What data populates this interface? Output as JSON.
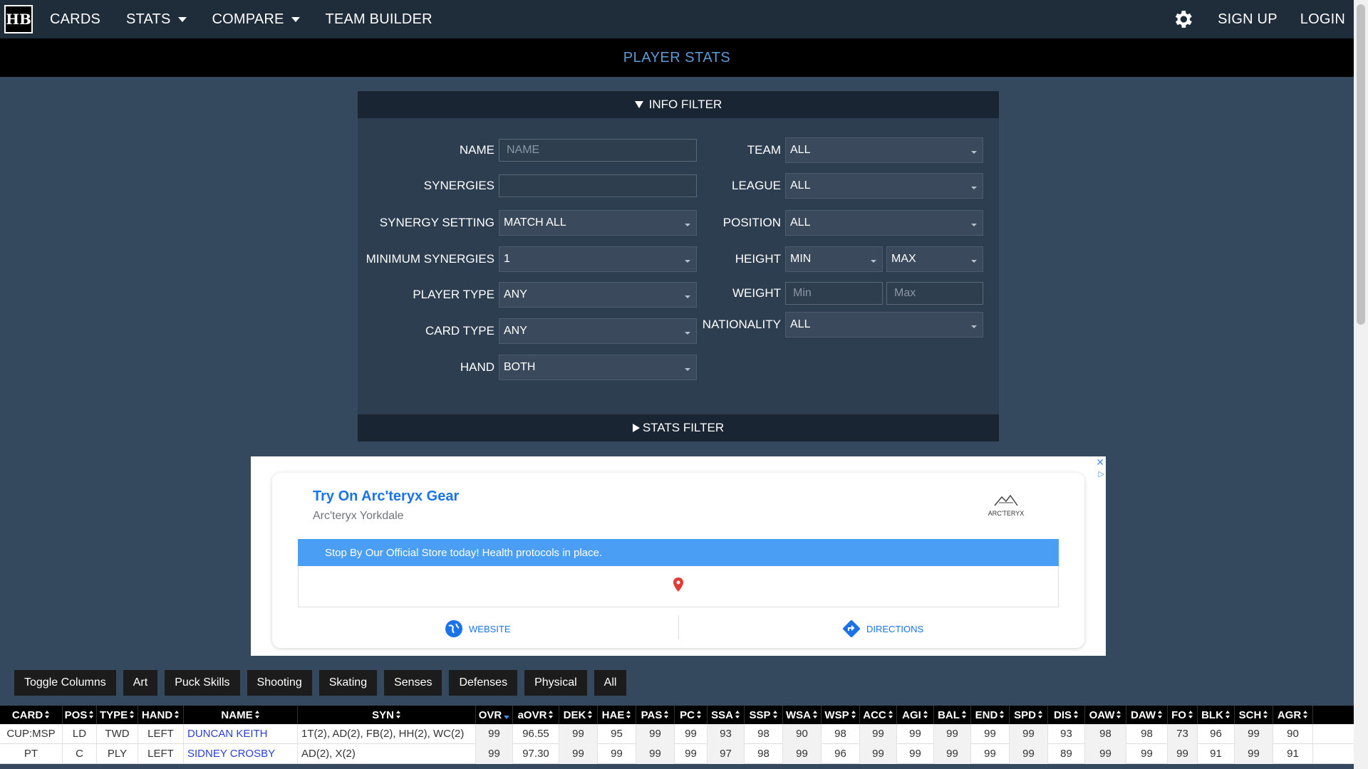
{
  "nav": {
    "logo": "HB",
    "items": [
      "CARDS",
      "STATS",
      "COMPARE",
      "TEAM BUILDER"
    ],
    "signup": "SIGN UP",
    "login": "LOGIN"
  },
  "page_title": "PLAYER STATS",
  "filter": {
    "info_label": "INFO FILTER",
    "stats_label": "STATS FILTER",
    "left": [
      {
        "label": "NAME",
        "value": "",
        "placeholder": "NAME",
        "kind": "input"
      },
      {
        "label": "SYNERGIES",
        "value": "",
        "kind": "input"
      },
      {
        "label": "SYNERGY SETTING",
        "value": "MATCH ALL",
        "kind": "select"
      },
      {
        "label": "MINIMUM SYNERGIES",
        "value": "1",
        "kind": "select"
      },
      {
        "label": "PLAYER TYPE",
        "value": "ANY",
        "kind": "select"
      },
      {
        "label": "CARD TYPE",
        "value": "ANY",
        "kind": "select"
      },
      {
        "label": "HAND",
        "value": "BOTH",
        "kind": "select"
      }
    ],
    "right": {
      "team": {
        "label": "TEAM",
        "value": "ALL"
      },
      "league": {
        "label": "LEAGUE",
        "value": "ALL"
      },
      "position": {
        "label": "POSITION",
        "value": "ALL"
      },
      "height": {
        "label": "HEIGHT",
        "min": "MIN",
        "max": "MAX"
      },
      "weight": {
        "label": "WEIGHT",
        "min_placeholder": "Min",
        "max_placeholder": "Max"
      },
      "nationality": {
        "label": "NATIONALITY",
        "value": "ALL"
      }
    }
  },
  "ad": {
    "title": "Try On Arc'teryx Gear",
    "subtitle": "Arc'teryx Yorkdale",
    "logo_text": "ARC'TERYX",
    "banner": "Stop By Our Official Store today! Health protocols in place.",
    "website": "WEBSITE",
    "directions": "DIRECTIONS",
    "accent": "#4a9ff5"
  },
  "toggles": [
    "Toggle Columns",
    "Art",
    "Puck Skills",
    "Shooting",
    "Skating",
    "Senses",
    "Defenses",
    "Physical",
    "All"
  ],
  "table": {
    "columns": [
      "CARD",
      "POS",
      "TYPE",
      "HAND",
      "NAME",
      "SYN",
      "OVR",
      "aOVR",
      "DEK",
      "HAE",
      "PAS",
      "PC",
      "SSA",
      "SSP",
      "WSA",
      "WSP",
      "ACC",
      "AGI",
      "BAL",
      "END",
      "SPD",
      "DIS",
      "OAW",
      "DAW",
      "FO",
      "BLK",
      "SCH",
      "AGR"
    ],
    "rows": [
      [
        "CUP:MSP",
        "LD",
        "TWD",
        "LEFT",
        "DUNCAN KEITH",
        "1T(2), AD(2), FB(2), HH(2), WC(2)",
        "99",
        "96.55",
        "99",
        "95",
        "99",
        "99",
        "93",
        "98",
        "90",
        "98",
        "99",
        "99",
        "99",
        "99",
        "99",
        "93",
        "98",
        "98",
        "73",
        "96",
        "99",
        "90"
      ],
      [
        "PT",
        "C",
        "PLY",
        "LEFT",
        "SIDNEY CROSBY",
        "AD(2), X(2)",
        "99",
        "97.30",
        "99",
        "99",
        "99",
        "99",
        "97",
        "98",
        "99",
        "96",
        "99",
        "99",
        "99",
        "99",
        "99",
        "89",
        "99",
        "99",
        "99",
        "91",
        "99",
        "91"
      ]
    ]
  }
}
